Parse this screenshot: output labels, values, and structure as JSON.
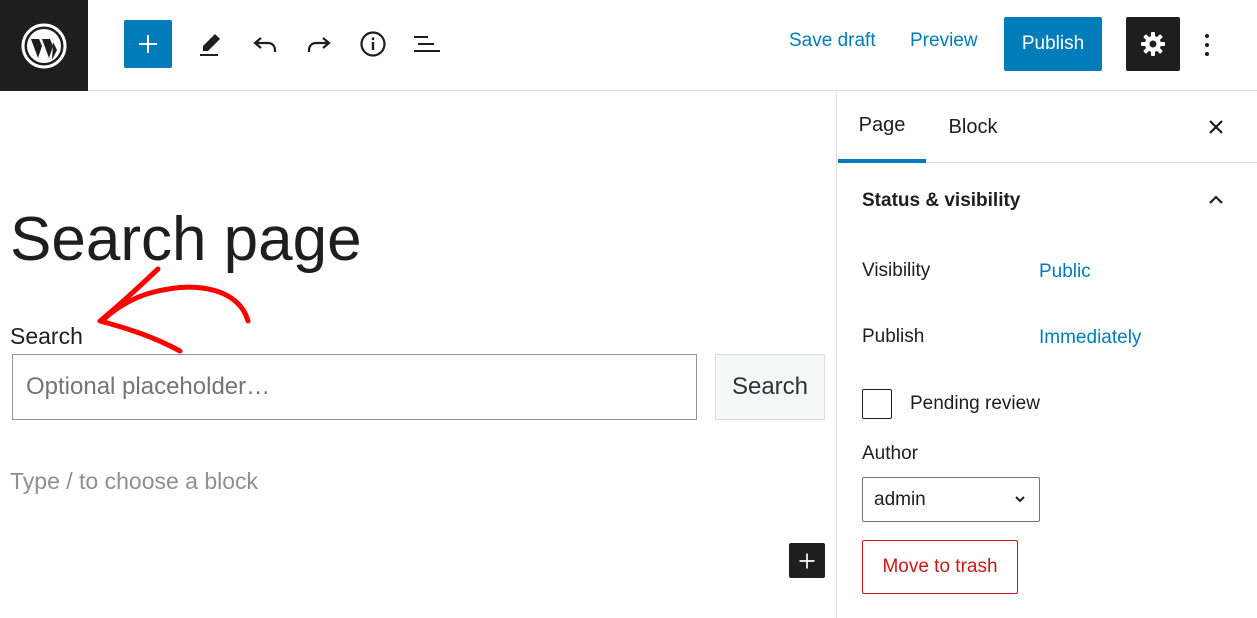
{
  "toolbar": {
    "save_draft": "Save draft",
    "preview": "Preview",
    "publish": "Publish",
    "icons": [
      "wordpress-logo",
      "plus-icon",
      "pencil-icon",
      "undo-icon",
      "redo-icon",
      "info-icon",
      "list-view-icon",
      "gear-icon",
      "more-vertical-icon"
    ]
  },
  "editor": {
    "title": "Search page",
    "search_label": "Search",
    "search_placeholder": "Optional placeholder…",
    "search_button": "Search",
    "block_hint": "Type / to choose a block"
  },
  "sidebar": {
    "tabs": [
      "Page",
      "Block"
    ],
    "active_tab": "Page",
    "panel_title": "Status & visibility",
    "visibility_label": "Visibility",
    "visibility_value": "Public",
    "publish_label": "Publish",
    "publish_value": "Immediately",
    "pending_review_label": "Pending review",
    "author_label": "Author",
    "author_value": "admin",
    "trash_label": "Move to trash"
  },
  "colors": {
    "accent": "#007cba",
    "dark": "#1e1e1e",
    "danger": "#cc1818",
    "annotation": "#ff0000"
  }
}
